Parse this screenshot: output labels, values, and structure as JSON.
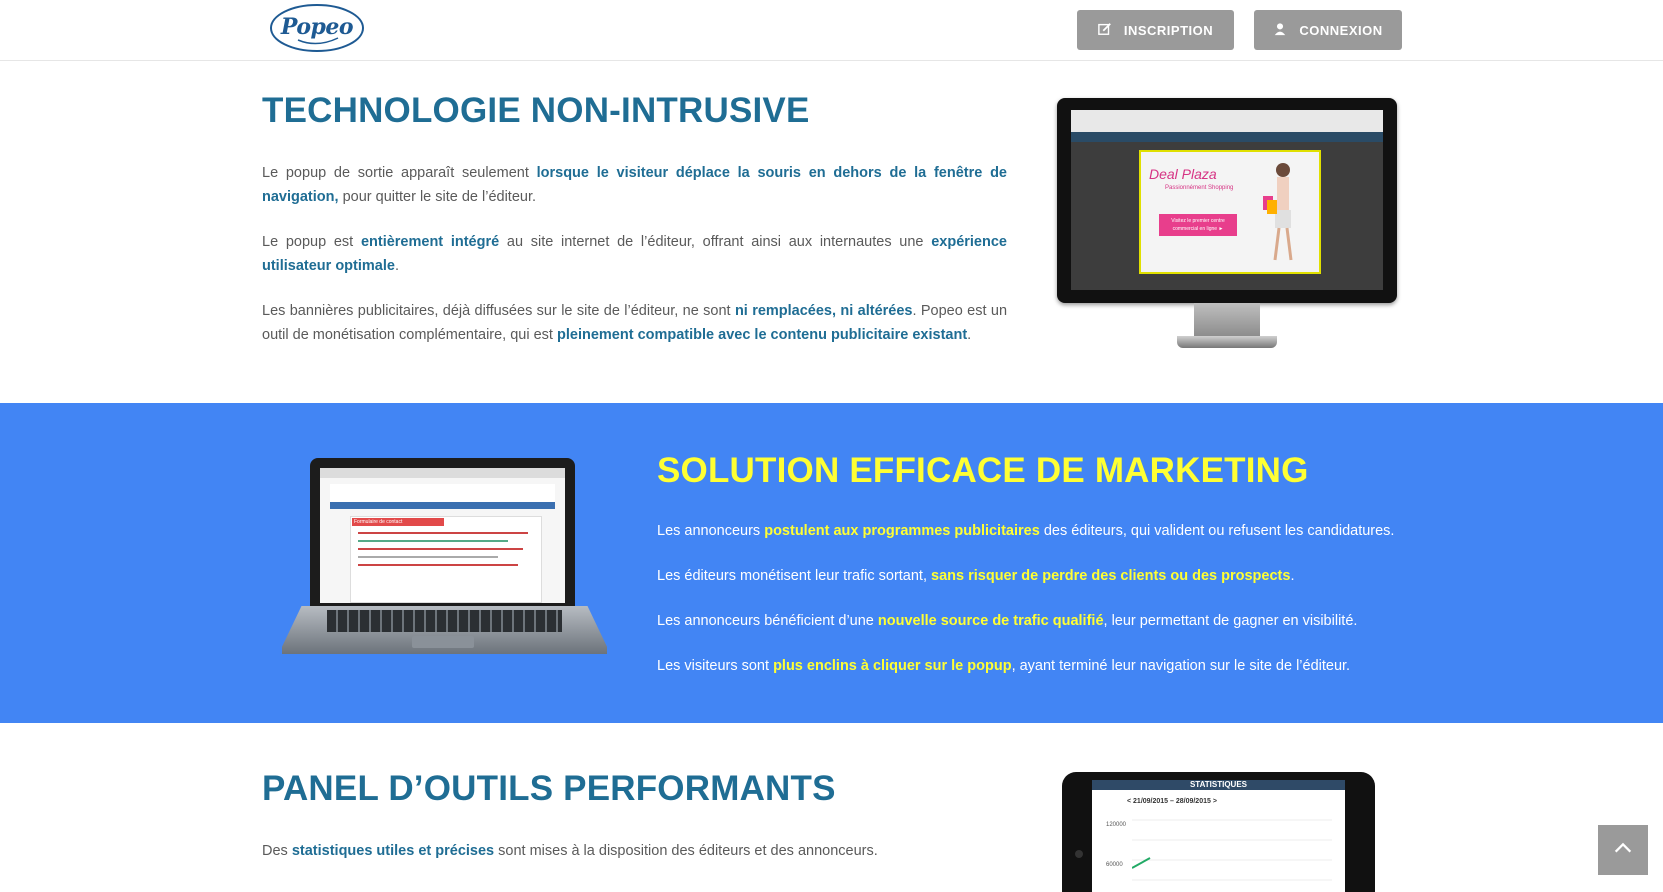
{
  "header": {
    "logo_text": "Popeo",
    "inscription_label": "INSCRIPTION",
    "connexion_label": "CONNEXION"
  },
  "section1": {
    "title": "TECHNOLOGIE NON-INTRUSIVE",
    "p1": {
      "a": "Le popup de sortie apparaît seulement ",
      "b": "lorsque le visiteur déplace la souris en dehors de la fenêtre de navigation,",
      "c": " pour quitter le site de l’éditeur."
    },
    "p2": {
      "a": "Le popup est ",
      "b": "entièrement intégré",
      "c": " au site internet de l’éditeur, offrant ainsi aux internautes une ",
      "d": "expérience utilisateur optimale",
      "e": "."
    },
    "p3": {
      "a": "Les bannières publicitaires, déjà diffusées sur le site de l’éditeur, ne sont ",
      "b": "ni remplacées, ni altérées",
      "c": ". Popeo est un outil de monétisation complémentaire, qui est ",
      "d": "pleinement compatible avec le contenu publicitaire existant",
      "e": "."
    },
    "popup_brand": "Deal Plaza",
    "popup_tagline": "Passionnément Shopping",
    "popup_button": "Visitez le premier centre commercial en ligne ►"
  },
  "section2": {
    "title": "SOLUTION EFFICACE DE MARKETING",
    "p1": {
      "a": "Les annonceurs ",
      "b": "postulent aux programmes publicitaires",
      "c": " des éditeurs, qui valident ou refusent les candidatures."
    },
    "p2": {
      "a": "Les éditeurs monétisent leur trafic sortant, ",
      "b": "sans risquer de perdre des clients ou des prospects",
      "c": "."
    },
    "p3": {
      "a": "Les annonceurs bénéficient d’une ",
      "b": "nouvelle source de trafic qualifié",
      "c": ", leur permettant de gagner en visibilité."
    },
    "p4": {
      "a": "Les visiteurs sont ",
      "b": "plus enclins à cliquer sur le popup",
      "c": ", ayant terminé leur navigation sur le site de l’éditeur."
    },
    "laptop_form_title": "Formulaire de contact"
  },
  "section3": {
    "title": "PANEL D’OUTILS PERFORMANTS",
    "p1": {
      "a": "Des ",
      "b": "statistiques utiles et précises",
      "c": " sont mises à la disposition des éditeurs et des annonceurs."
    },
    "tablet_title": "STATISTIQUES",
    "tablet_dates": "< 21/09/2015 – 28/09/2015 >",
    "tablet_y1": "120000",
    "tablet_y2": "60000"
  },
  "colors": {
    "accent_blue": "#1f6d94",
    "band_blue": "#4285f4",
    "highlight_yellow": "#ffff33",
    "button_gray": "#9a9a9a"
  },
  "icons": [
    "edit-icon",
    "user-icon",
    "chevron-up-icon"
  ]
}
